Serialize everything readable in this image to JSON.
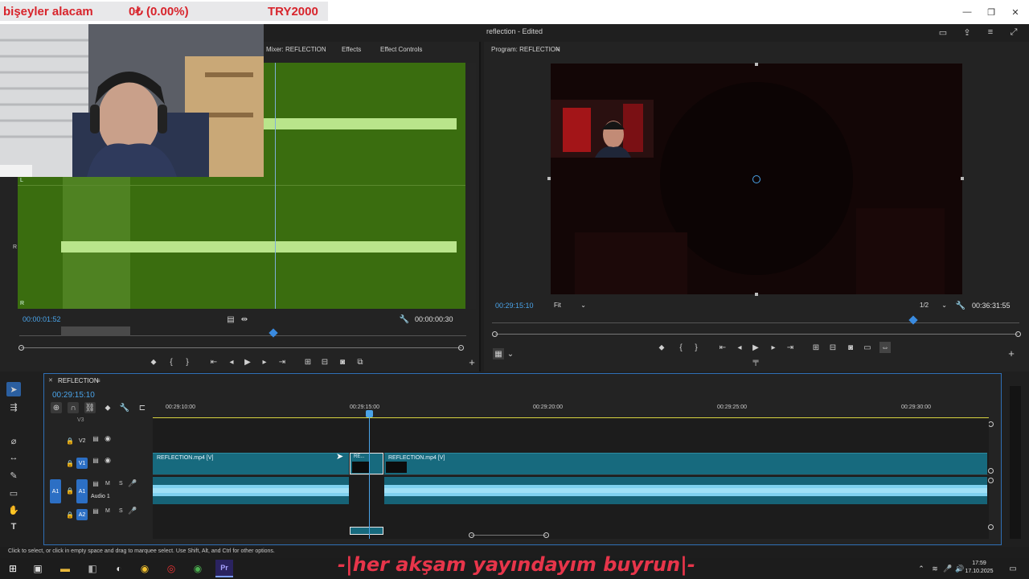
{
  "donation_banner": {
    "message": "bişeyler alacam",
    "amount": "0₺ (0.00%)",
    "goal": "TRY2000"
  },
  "window_controls": {
    "minimize": "—",
    "maximize": "❐",
    "close": "✕"
  },
  "workspace_title": "reflection - Edited",
  "source_panel": {
    "tabs": [
      "Mixer: REFLECTION",
      "Effects",
      "Effect Controls"
    ],
    "timecode_current": "00:00:01:52",
    "timecode_duration": "00:00:00:30",
    "channel_labels": [
      "L",
      "R",
      "R"
    ]
  },
  "program_panel": {
    "title": "Program: REFLECTION",
    "timecode_current": "00:29:15:10",
    "fit": "Fit",
    "resolution": "1/2",
    "timecode_duration": "00:36:31:55"
  },
  "timeline": {
    "sequence_name": "REFLECTION",
    "timecode": "00:29:15:10",
    "ruler_labels": [
      "00:29:10:00",
      "00:29:15:00",
      "00:29:20:00",
      "00:29:25:00",
      "00:29:30:00"
    ],
    "tracks": {
      "v3": "V3",
      "v2": "V2",
      "v1": "V1",
      "a1": "A1",
      "a2": "A2",
      "audio1_name": "Audio 1",
      "mute": "M",
      "solo": "S"
    },
    "clips": {
      "clip1": "REFLECTION.mp4 [V]",
      "clip2": "RE...",
      "clip3": "REFLECTION.mp4 [V]"
    }
  },
  "status_bar": "Click to select, or click in empty space and drag to marquee select. Use Shift, Alt, and Ctrl for other options.",
  "overlay_text": "-|her akşam yayındayım buyrun|-",
  "taskbar": {
    "time": "17:59",
    "date": "17.10.2025"
  },
  "colors": {
    "accent": "#4aa3e8",
    "waveform_bg": "#3a6d0f",
    "clip_video": "#176a7e",
    "donation_text": "#d8242c",
    "overlay_text": "#e7354a"
  }
}
